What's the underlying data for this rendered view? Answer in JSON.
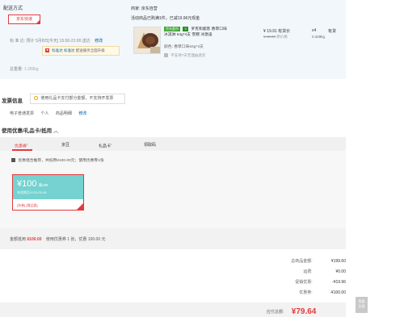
{
  "shipping": {
    "section_label": "配送方式",
    "selected_method": "京东快递",
    "delivery_line": "标  准  达:  预计 5月8日[今天] 15:00-21:00 送达",
    "edit_label": "修改",
    "tip": {
      "badges": "标准达  标准达",
      "text": "配送服务全面升级"
    },
    "weight_label": "总重量:",
    "weight_value": "1.260kg"
  },
  "shop": {
    "label": "商家:",
    "name": "京东自营",
    "promo": "活动商品已购满1件，已减19.96元现金"
  },
  "product": {
    "tag1": "京东超市",
    "tag2": "X",
    "title_line1": "罗克和鹿客 香草口味",
    "title_line2": "冰淇淋 64g*4支 雪糕 冰激凌",
    "spec": "颜色: 香草口味64g*4支",
    "no_return": "不支持7天无理由退货",
    "price": "¥ 19.91",
    "price_note": "有货价",
    "orig_price": "¥ 49.90",
    "orig_note": "原价格",
    "qty": "x4",
    "weight": "0.328kg",
    "stock": "有货"
  },
  "invoice": {
    "label": "发票信息",
    "notice": "使用礼品卡支付部分金额，不支持开发票",
    "type": "电子普通发票",
    "title": "个人",
    "content": "商品明细",
    "edit_label": "修改"
  },
  "coupons": {
    "section_label": "使用优惠/礼品卡/抵用",
    "toggle_icon": "chevron-up-icon",
    "tabs": [
      {
        "label": "优惠券",
        "mark": "•"
      },
      {
        "label": "京豆",
        "mark": ""
      },
      {
        "label": "礼品卡",
        "mark": "•"
      },
      {
        "label": "领取码",
        "mark": ""
      }
    ],
    "auto_label": "优惠组合推荐，共抵用¥100.00元；使用优惠券1张",
    "coupon": {
      "amount": "¥100",
      "type": "满199",
      "expiry": "有效期至2025-05-08",
      "condition": "[东券]  [限品类]"
    },
    "summary_prefix": "金额抵用",
    "summary_amount": "¥100.00",
    "summary_suffix": "使用优惠券 1 张，优惠 100.00 元"
  },
  "totals": {
    "rows": [
      {
        "label": "总商品金额:",
        "value": "¥199.60"
      },
      {
        "label": "运费:",
        "value": "¥0.00"
      },
      {
        "label": "促销优惠:",
        "value": "-¥19.96"
      },
      {
        "label": "优惠券:",
        "value": "-¥100.00"
      }
    ],
    "pay_label": "应付总额:",
    "pay_amount": "¥79.64"
  },
  "feedback": {
    "line1": "我要",
    "line2": "反馈"
  },
  "colors": {
    "accent": "#e4393c",
    "coupon_teal": "#75d2d0",
    "link": "#005ea7"
  }
}
